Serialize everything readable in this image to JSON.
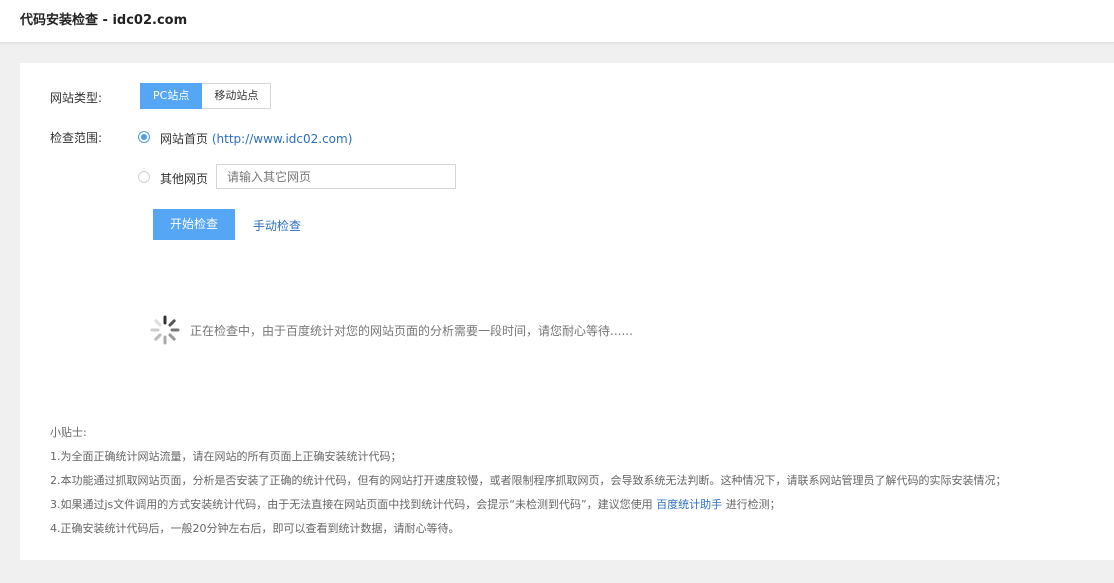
{
  "header": {
    "title": "代码安装检查 - idc02.com"
  },
  "form": {
    "site_type_label": "网站类型:",
    "site_types": [
      {
        "label": "PC站点",
        "active": true
      },
      {
        "label": "移动站点",
        "active": false
      }
    ],
    "scope_label": "检查范围:",
    "options": {
      "home": {
        "label": "网站首页",
        "url": "(http://www.idc02.com)",
        "checked": true
      },
      "other": {
        "label": "其他网页",
        "checked": false,
        "value": "",
        "placeholder": "请输入其它网页"
      }
    },
    "start_label": "开始检查",
    "manual_label": "手动检查"
  },
  "status": {
    "loading_text": "正在检查中，由于百度统计对您的网站页面的分析需要一段时间，请您耐心等待......"
  },
  "tips": {
    "title": "小贴士:",
    "line1": "1.为全面正确统计网站流量，请在网站的所有页面上正确安装统计代码；",
    "line2": "2.本功能通过抓取网站页面，分析是否安装了正确的统计代码，但有的网站打开速度较慢，或者限制程序抓取网页，会导致系统无法判断。这种情况下，请联系网站管理员了解代码的实际安装情况；",
    "line3_pre": "3.如果通过js文件调用的方式安装统计代码，由于无法直接在网站页面中找到统计代码，会提示“未检测到代码”，建议您使用",
    "line3_link": "百度统计助手",
    "line3_post": "进行检测；",
    "line4": "4.正确安装统计代码后，一般20分钟左右后，即可以查看到统计数据，请耐心等待。"
  },
  "colors": {
    "accent": "#55a6f5",
    "link": "#2a6fc0",
    "background": "#f0f0f0"
  },
  "icons": {
    "loading": "spinner-icon"
  }
}
